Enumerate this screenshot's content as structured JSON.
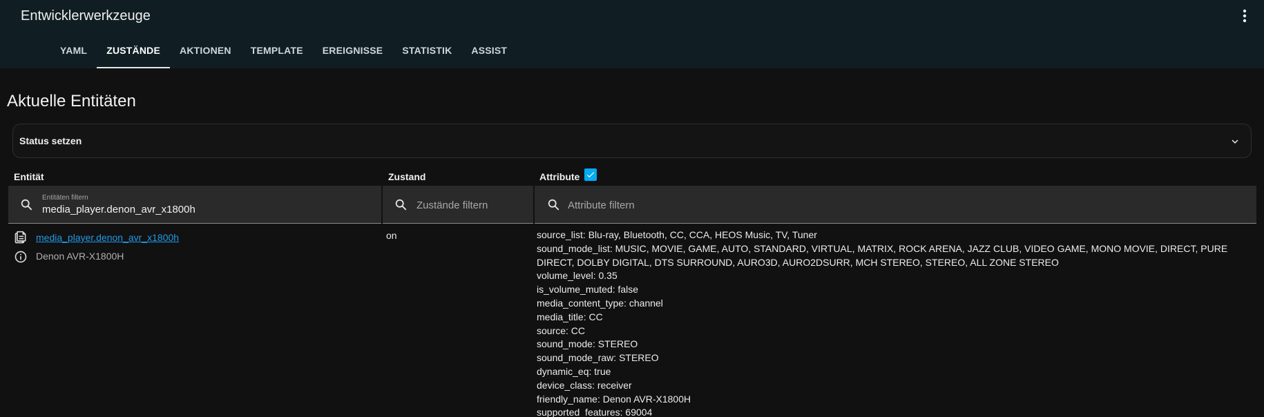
{
  "app": {
    "title": "Entwicklerwerkzeuge"
  },
  "tabs": [
    {
      "label": "YAML",
      "active": false
    },
    {
      "label": "ZUSTÄNDE",
      "active": true
    },
    {
      "label": "AKTIONEN",
      "active": false
    },
    {
      "label": "TEMPLATE",
      "active": false
    },
    {
      "label": "EREIGNISSE",
      "active": false
    },
    {
      "label": "STATISTIK",
      "active": false
    },
    {
      "label": "ASSIST",
      "active": false
    }
  ],
  "page": {
    "title": "Aktuelle Entitäten"
  },
  "set_state": {
    "label": "Status setzen",
    "expanded": false
  },
  "columns": {
    "entity": "Entität",
    "state": "Zustand",
    "attributes": "Attribute",
    "attributes_checked": true
  },
  "filters": {
    "entity": {
      "label": "Entitäten filtern",
      "value": "media_player.denon_avr_x1800h"
    },
    "state": {
      "placeholder": "Zustände filtern",
      "value": ""
    },
    "attributes": {
      "placeholder": "Attribute filtern",
      "value": ""
    }
  },
  "row": {
    "entity_id": "media_player.denon_avr_x1800h",
    "friendly_name": "Denon AVR-X1800H",
    "state": "on",
    "attributes": [
      "source_list: Blu-ray, Bluetooth, CC, CCA, HEOS Music, TV, Tuner",
      "sound_mode_list: MUSIC, MOVIE, GAME, AUTO, STANDARD, VIRTUAL, MATRIX, ROCK ARENA, JAZZ CLUB, VIDEO GAME, MONO MOVIE, DIRECT, PURE DIRECT, DOLBY DIGITAL, DTS SURROUND, AURO3D, AURO2DSURR, MCH STEREO, STEREO, ALL ZONE STEREO",
      "volume_level: 0.35",
      "is_volume_muted: false",
      "media_content_type: channel",
      "media_title: CC",
      "source: CC",
      "sound_mode: STEREO",
      "sound_mode_raw: STEREO",
      "dynamic_eq: true",
      "device_class: receiver",
      "friendly_name: Denon AVR-X1800H",
      "supported_features: 69004"
    ]
  },
  "icons": {
    "menu": "dots-vertical-icon",
    "chevron": "chevron-down-icon",
    "search": "magnify-icon",
    "copy": "clipboard-list-icon",
    "info": "information-outline-icon",
    "check": "checkbox-marked-icon"
  },
  "colors": {
    "accent": "#03a9f4",
    "link": "#1e9be6",
    "header": "#101e24"
  }
}
